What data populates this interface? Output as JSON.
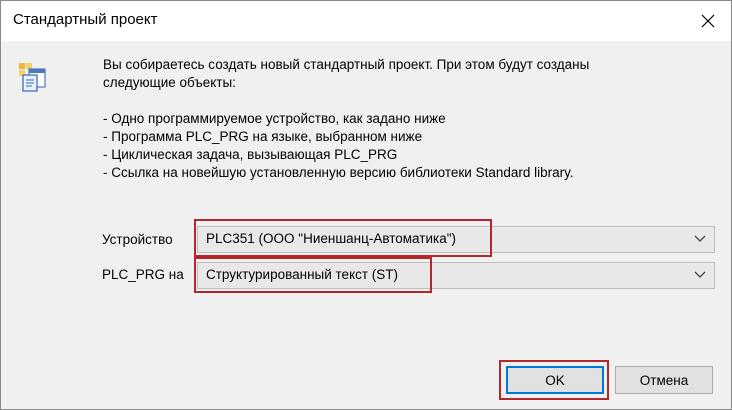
{
  "window": {
    "title": "Стандартный проект"
  },
  "description": {
    "intro_line1": "Вы собираетесь создать новый стандартный проект. При этом будут созданы",
    "intro_line2": "следующие объекты:",
    "items": [
      "- Одно программируемое устройство, как задано ниже",
      "- Программа PLC_PRG на языке, выбранном ниже",
      "- Циклическая задача, вызывающая PLC_PRG",
      "- Ссылка на новейшую установленную версию библиотеки Standard library."
    ]
  },
  "form": {
    "device_label": "Устройство",
    "device_value": "PLC351 (ООО \"Ниеншанц-Автоматика\")",
    "language_label": "PLC_PRG на",
    "language_value": "Структурированный текст (ST)"
  },
  "buttons": {
    "ok_label": "OK",
    "cancel_label": "Отмена"
  },
  "colors": {
    "highlight": "#b3262b",
    "ok_focus": "#0078d7"
  },
  "icons": {
    "close": "close-icon",
    "app": "project-icon",
    "dropdown": "chevron-down-icon"
  }
}
